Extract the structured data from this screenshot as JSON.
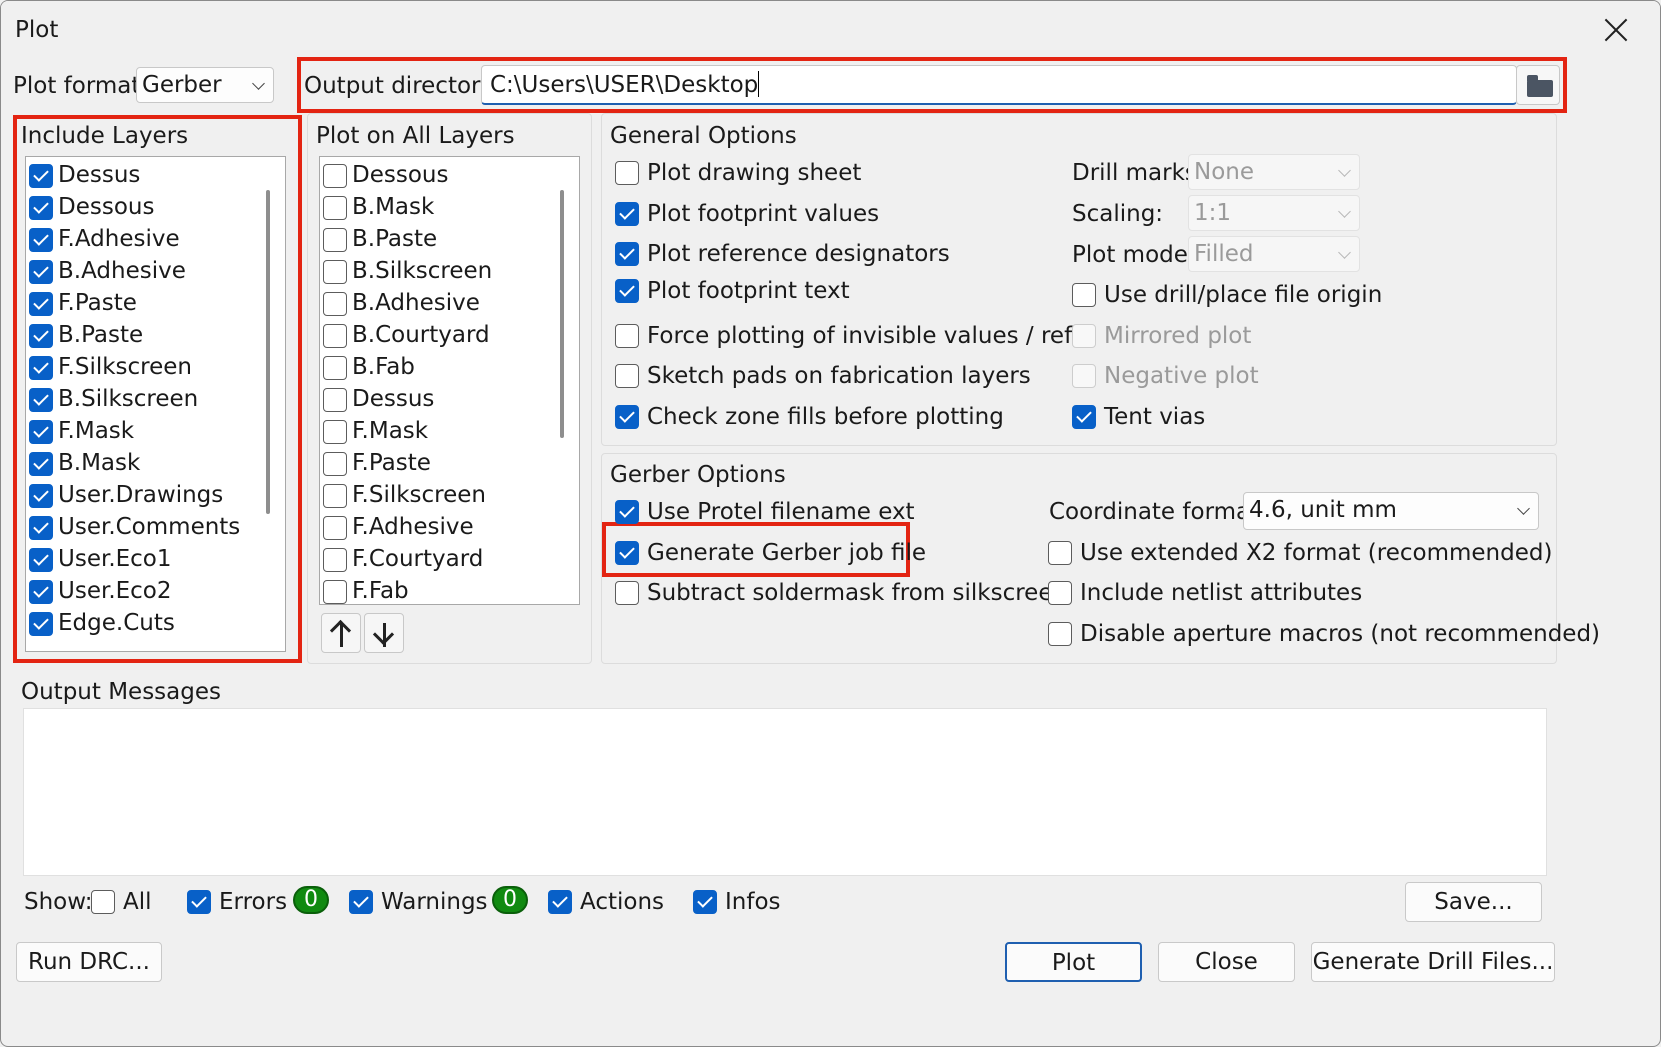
{
  "window": {
    "title": "Plot"
  },
  "top": {
    "plot_format_label": "Plot format:",
    "plot_format_value": "Gerber",
    "output_dir_label": "Output directory:",
    "output_dir_value": "C:\\Users\\USER\\Desktop"
  },
  "include_layers": {
    "title": "Include Layers",
    "items": [
      {
        "label": "Dessus",
        "checked": true
      },
      {
        "label": "Dessous",
        "checked": true
      },
      {
        "label": "F.Adhesive",
        "checked": true
      },
      {
        "label": "B.Adhesive",
        "checked": true
      },
      {
        "label": "F.Paste",
        "checked": true
      },
      {
        "label": "B.Paste",
        "checked": true
      },
      {
        "label": "F.Silkscreen",
        "checked": true
      },
      {
        "label": "B.Silkscreen",
        "checked": true
      },
      {
        "label": "F.Mask",
        "checked": true
      },
      {
        "label": "B.Mask",
        "checked": true
      },
      {
        "label": "User.Drawings",
        "checked": true
      },
      {
        "label": "User.Comments",
        "checked": true
      },
      {
        "label": "User.Eco1",
        "checked": true
      },
      {
        "label": "User.Eco2",
        "checked": true
      },
      {
        "label": "Edge.Cuts",
        "checked": true
      }
    ]
  },
  "all_layers": {
    "title": "Plot on All Layers",
    "items": [
      {
        "label": "Dessous",
        "checked": false
      },
      {
        "label": "B.Mask",
        "checked": false
      },
      {
        "label": "B.Paste",
        "checked": false
      },
      {
        "label": "B.Silkscreen",
        "checked": false
      },
      {
        "label": "B.Adhesive",
        "checked": false
      },
      {
        "label": "B.Courtyard",
        "checked": false
      },
      {
        "label": "B.Fab",
        "checked": false
      },
      {
        "label": "Dessus",
        "checked": false
      },
      {
        "label": "F.Mask",
        "checked": false
      },
      {
        "label": "F.Paste",
        "checked": false
      },
      {
        "label": "F.Silkscreen",
        "checked": false
      },
      {
        "label": "F.Adhesive",
        "checked": false
      },
      {
        "label": "F.Courtyard",
        "checked": false
      },
      {
        "label": "F.Fab",
        "checked": false
      }
    ]
  },
  "general": {
    "title": "General Options",
    "left_options": [
      {
        "label": "Plot drawing sheet",
        "checked": false
      },
      {
        "label": "Plot footprint values",
        "checked": true
      },
      {
        "label": "Plot reference designators",
        "checked": true
      },
      {
        "label": "Plot footprint text",
        "checked": true
      },
      {
        "label": "Force plotting of invisible values / refs",
        "checked": false
      },
      {
        "label": "Sketch pads on fabrication layers",
        "checked": false
      },
      {
        "label": "Check zone fills before plotting",
        "checked": true
      }
    ],
    "drill_marks_label": "Drill marks:",
    "drill_marks_value": "None",
    "scaling_label": "Scaling:",
    "scaling_value": "1:1",
    "plot_mode_label": "Plot mode:",
    "plot_mode_value": "Filled",
    "right_options": [
      {
        "label": "Use drill/place file origin",
        "checked": false,
        "disabled": false
      },
      {
        "label": "Mirrored plot",
        "checked": false,
        "disabled": true
      },
      {
        "label": "Negative plot",
        "checked": false,
        "disabled": true
      },
      {
        "label": "Tent vias",
        "checked": true,
        "disabled": false
      }
    ]
  },
  "gerber": {
    "title": "Gerber Options",
    "left_options": [
      {
        "label": "Use Protel filename ext",
        "checked": true
      },
      {
        "label": "Generate Gerber job file",
        "checked": true
      },
      {
        "label": "Subtract soldermask from silkscreen",
        "checked": false
      }
    ],
    "coord_label": "Coordinate format:",
    "coord_value": "4.6, unit mm",
    "right_options": [
      {
        "label": "Use extended X2 format (recommended)",
        "checked": false
      },
      {
        "label": "Include netlist attributes",
        "checked": false
      },
      {
        "label": "Disable aperture macros (not recommended)",
        "checked": false
      }
    ]
  },
  "messages": {
    "title": "Output Messages",
    "show_label": "Show:",
    "all_label": "All",
    "errors_label": "Errors",
    "errors_count": "0",
    "warnings_label": "Warnings",
    "warnings_count": "0",
    "actions_label": "Actions",
    "infos_label": "Infos",
    "save_label": "Save..."
  },
  "footer": {
    "run_drc": "Run DRC...",
    "plot": "Plot",
    "close": "Close",
    "generate_drill": "Generate Drill Files..."
  }
}
